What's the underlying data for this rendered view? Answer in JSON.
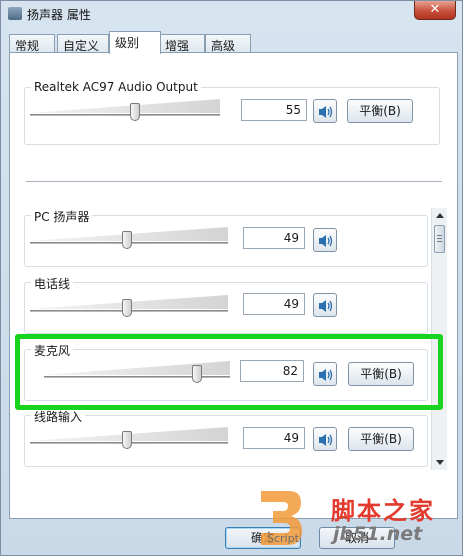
{
  "window": {
    "title": "扬声器 属性",
    "close_glyph": "✕"
  },
  "tabs": [
    {
      "label": "常规"
    },
    {
      "label": "自定义"
    },
    {
      "label": "级别"
    },
    {
      "label": "增强"
    },
    {
      "label": "高级"
    }
  ],
  "active_tab": "级别",
  "master": {
    "label": "Realtek AC97 Audio Output",
    "value": "55",
    "level": 0.55,
    "balance_label": "平衡(B)"
  },
  "devices": [
    {
      "label": "PC 扬声器",
      "value": "49",
      "level": 0.49,
      "balance_label": ""
    },
    {
      "label": "电话线",
      "value": "49",
      "level": 0.49,
      "balance_label": ""
    },
    {
      "label": "麦克风",
      "value": "82",
      "level": 0.82,
      "balance_label": "平衡(B)"
    },
    {
      "label": "线路输入",
      "value": "49",
      "level": 0.49,
      "balance_label": "平衡(B)"
    }
  ],
  "buttons": {
    "ok": "确定",
    "cancel": "取消"
  },
  "watermark": {
    "site_name": "脚本之家",
    "url": "jb51.net",
    "script_text": "Script"
  },
  "colors": {
    "highlight": "#19d41e",
    "watermark_red": "#e23b2e"
  },
  "icons": {
    "speaker": "speaker-icon",
    "title": "speaker-app-icon"
  }
}
